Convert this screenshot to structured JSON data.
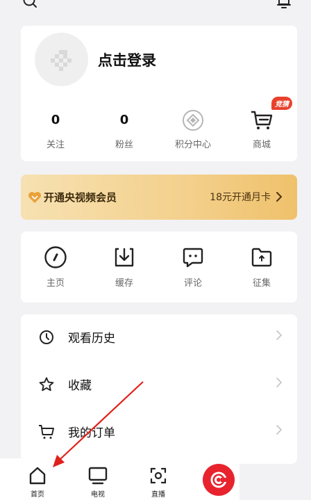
{
  "profile": {
    "login_label": "点击登录",
    "stats": [
      {
        "value": "0",
        "label": "关注"
      },
      {
        "value": "0",
        "label": "粉丝"
      },
      {
        "label": "积分中心",
        "icon": "points-icon"
      },
      {
        "label": "商城",
        "icon": "cart-icon",
        "badge": "竞猜"
      }
    ]
  },
  "vip": {
    "title": "开通央视频会员",
    "cta": "18元开通月卡"
  },
  "quick_actions": [
    {
      "label": "主页",
      "icon": "homepage-compass-icon"
    },
    {
      "label": "缓存",
      "icon": "download-icon"
    },
    {
      "label": "评论",
      "icon": "comment-icon"
    },
    {
      "label": "征集",
      "icon": "folder-icon"
    }
  ],
  "menu": [
    {
      "label": "观看历史",
      "icon": "clock-icon"
    },
    {
      "label": "收藏",
      "icon": "star-icon"
    },
    {
      "label": "我的订单",
      "icon": "cart-icon"
    }
  ],
  "tabbar": [
    {
      "label": "首页",
      "icon": "home-icon"
    },
    {
      "label": "电视",
      "icon": "tv-icon"
    },
    {
      "label": "直播",
      "icon": "live-icon"
    }
  ],
  "colors": {
    "accent_red": "#e8232e",
    "vip_gold": "#f3d08c",
    "annotation_arrow": "#e0201a"
  }
}
